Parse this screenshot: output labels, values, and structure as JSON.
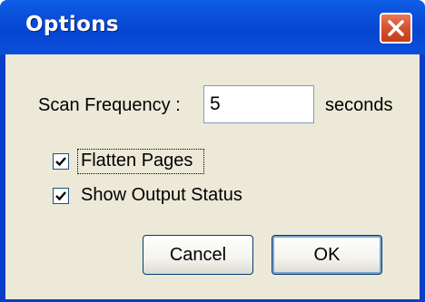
{
  "window": {
    "title": "Options"
  },
  "scan_frequency": {
    "label": "Scan Frequency :",
    "value": "5",
    "unit": "seconds"
  },
  "options": {
    "flatten_pages": {
      "label": "Flatten Pages",
      "checked": true
    },
    "show_output_status": {
      "label": "Show Output Status",
      "checked": true
    }
  },
  "buttons": {
    "cancel_label": "Cancel",
    "ok_label": "OK"
  },
  "colors": {
    "titlebar": "#0a4fd8",
    "client_bg": "#ece9d8",
    "close_button": "#d8542f"
  }
}
